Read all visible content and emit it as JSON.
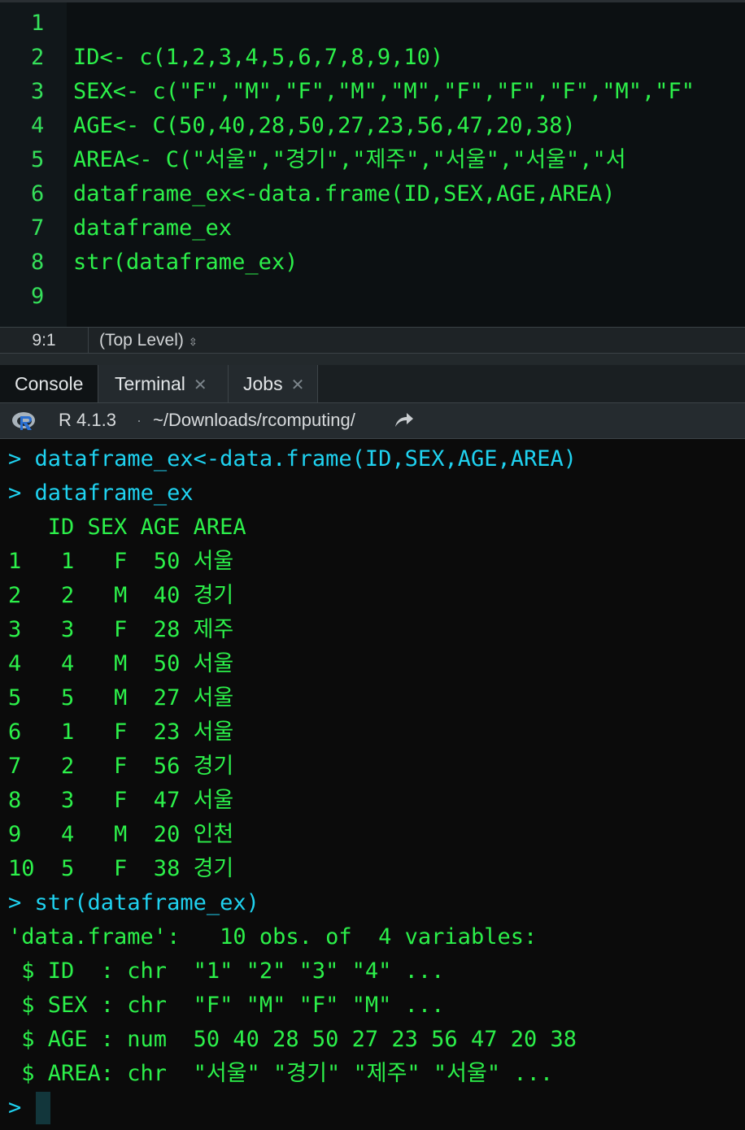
{
  "editor": {
    "lines": [
      {
        "num": "1",
        "text": ""
      },
      {
        "num": "2",
        "text": "ID<- c(1,2,3,4,5,6,7,8,9,10)"
      },
      {
        "num": "3",
        "text": "SEX<- c(\"F\",\"M\",\"F\",\"M\",\"M\",\"F\",\"F\",\"F\",\"M\",\"F\""
      },
      {
        "num": "4",
        "text": "AGE<- C(50,40,28,50,27,23,56,47,20,38)"
      },
      {
        "num": "5",
        "text": "AREA<- C(\"서울\",\"경기\",\"제주\",\"서울\",\"서울\",\"서"
      },
      {
        "num": "6",
        "text": "dataframe_ex<-data.frame(ID,SEX,AGE,AREA)"
      },
      {
        "num": "7",
        "text": "dataframe_ex"
      },
      {
        "num": "8",
        "text": "str(dataframe_ex)"
      },
      {
        "num": "9",
        "text": ""
      }
    ]
  },
  "status_bar": {
    "cursor_position": "9:1",
    "scope": "(Top Level)",
    "scope_icon": "updown-icon"
  },
  "tabs": [
    {
      "label": "Console",
      "active": true,
      "closable": false
    },
    {
      "label": "Terminal",
      "active": false,
      "closable": true
    },
    {
      "label": "Jobs",
      "active": false,
      "closable": true
    }
  ],
  "console_header": {
    "r_version": "R 4.1.3",
    "separator": "·",
    "working_dir": "~/Downloads/rcomputing/",
    "icon": "share-arrow-icon"
  },
  "console": {
    "prompt": ">",
    "lines": [
      {
        "type": "cmd",
        "text": "dataframe_ex<-data.frame(ID,SEX,AGE,AREA)"
      },
      {
        "type": "cmd",
        "text": "dataframe_ex"
      },
      {
        "type": "out",
        "text": "   ID SEX AGE AREA"
      },
      {
        "type": "out",
        "text": "1   1   F  50 서울"
      },
      {
        "type": "out",
        "text": "2   2   M  40 경기"
      },
      {
        "type": "out",
        "text": "3   3   F  28 제주"
      },
      {
        "type": "out",
        "text": "4   4   M  50 서울"
      },
      {
        "type": "out",
        "text": "5   5   M  27 서울"
      },
      {
        "type": "out",
        "text": "6   1   F  23 서울"
      },
      {
        "type": "out",
        "text": "7   2   F  56 경기"
      },
      {
        "type": "out",
        "text": "8   3   F  47 서울"
      },
      {
        "type": "out",
        "text": "9   4   M  20 인천"
      },
      {
        "type": "out",
        "text": "10  5   F  38 경기"
      },
      {
        "type": "cmd",
        "text": "str(dataframe_ex)"
      },
      {
        "type": "out",
        "text": "'data.frame':   10 obs. of  4 variables:"
      },
      {
        "type": "out",
        "text": " $ ID  : chr  \"1\" \"2\" \"3\" \"4\" ..."
      },
      {
        "type": "out",
        "text": " $ SEX : chr  \"F\" \"M\" \"F\" \"M\" ..."
      },
      {
        "type": "out",
        "text": " $ AGE : num  50 40 28 50 27 23 56 47 20 38"
      },
      {
        "type": "out",
        "text": " $ AREA: chr  \"서울\" \"경기\" \"제주\" \"서울\" ..."
      },
      {
        "type": "prompt",
        "text": ""
      }
    ]
  },
  "colors": {
    "code_green": "#2cf04a",
    "command_cyan": "#1fd2f0",
    "background": "#0b0b0b"
  }
}
